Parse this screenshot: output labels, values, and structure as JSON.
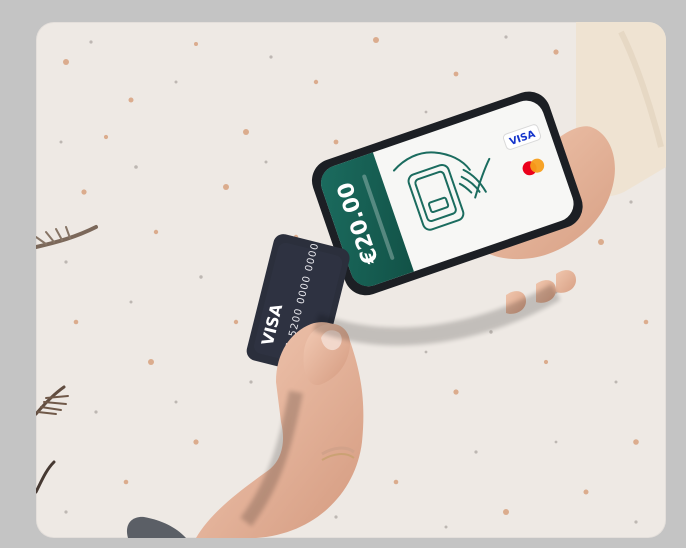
{
  "scene": {
    "phone": {
      "amount": "€20.00",
      "brands": [
        "VISA",
        "mastercard"
      ]
    },
    "card": {
      "number": "4871 5200 0000 0000",
      "brand": "VISA"
    }
  },
  "colors": {
    "background_frame": "#c4c4c4",
    "terrazzo": "#eee9e4",
    "phone_green": "#1f6f62",
    "card_dark": "#2b2f3c",
    "sleeve": "#efe3d2",
    "skin": "#e8b79c"
  }
}
